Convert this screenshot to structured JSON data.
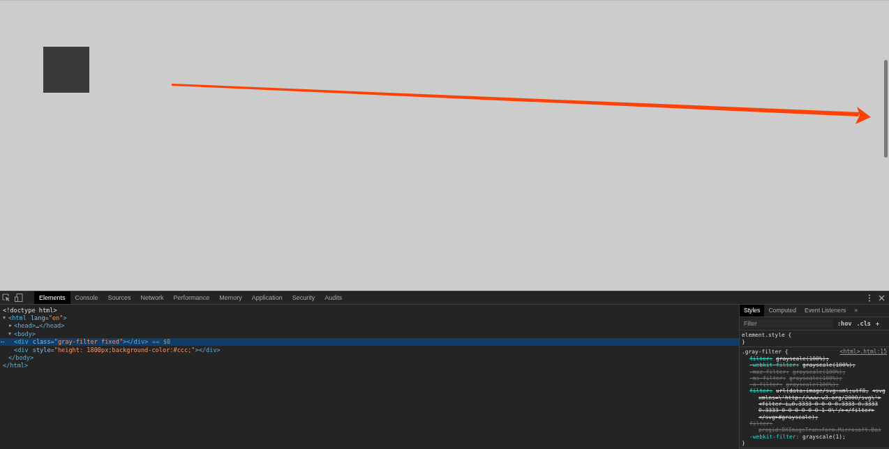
{
  "devtools": {
    "tabs": [
      {
        "label": "Elements",
        "selected": true
      },
      {
        "label": "Console",
        "selected": false
      },
      {
        "label": "Sources",
        "selected": false
      },
      {
        "label": "Network",
        "selected": false
      },
      {
        "label": "Performance",
        "selected": false
      },
      {
        "label": "Memory",
        "selected": false
      },
      {
        "label": "Application",
        "selected": false
      },
      {
        "label": "Security",
        "selected": false
      },
      {
        "label": "Audits",
        "selected": false
      }
    ],
    "dom_tree": [
      {
        "parts": [
          {
            "kind": "plain",
            "text": "<!doctype html>"
          }
        ],
        "selected": false
      },
      {
        "parts": [
          {
            "kind": "tag",
            "text": "<html"
          },
          {
            "kind": "attr",
            "text": "lang="
          },
          {
            "kind": "value",
            "text": "\"en\""
          },
          {
            "kind": "tagend",
            "text": ">"
          }
        ],
        "selected": false,
        "expanded": true,
        "closing": "</html>",
        "children": [
          {
            "parts": [
              {
                "kind": "tag",
                "text": "<head>"
              },
              {
                "kind": "plain",
                "text": "…"
              },
              {
                "kind": "tagend",
                "text": "</head>"
              }
            ],
            "selected": false,
            "expanded": false
          },
          {
            "parts": [
              {
                "kind": "tag",
                "text": "<body>"
              }
            ],
            "selected": false,
            "expanded": true,
            "closing": "</body>",
            "children": [
              {
                "parts": [
                  {
                    "kind": "tag",
                    "text": "<div"
                  },
                  {
                    "kind": "attr",
                    "text": "class="
                  },
                  {
                    "kind": "value",
                    "text": "\"gray-filter fixed\""
                  },
                  {
                    "kind": "tagend",
                    "text": "></div>"
                  },
                  {
                    "kind": "marker",
                    "text": "== $0"
                  }
                ],
                "selected": true
              },
              {
                "parts": [
                  {
                    "kind": "tag",
                    "text": "<div"
                  },
                  {
                    "kind": "attr",
                    "text": "style="
                  },
                  {
                    "kind": "value",
                    "text": "\"height: 1800px;background-color:#ccc;\""
                  },
                  {
                    "kind": "tagend",
                    "text": "></div>"
                  }
                ],
                "selected": false
              }
            ]
          }
        ]
      }
    ],
    "sidebar": {
      "tabs": [
        {
          "label": "Styles",
          "selected": true
        },
        {
          "label": "Computed",
          "selected": false
        },
        {
          "label": "Event Listeners",
          "selected": false
        },
        {
          "label": "»",
          "selected": false
        }
      ],
      "filter": {
        "placeholder": "Filter"
      },
      "buttons": [
        ":hov",
        ".cls",
        "+"
      ],
      "rules": [
        {
          "selector": "element.style {",
          "close": "}"
        },
        {
          "selector": ".gray-filter {",
          "source": "<html>.html:15",
          "close": "}",
          "declarations": [
            {
              "property": "filter:",
              "value": [
                "grayscale(100%);"
              ],
              "overridden": true,
              "invalid": false
            },
            {
              "property": "-webkit-filter:",
              "value": [
                "grayscale(100%);"
              ],
              "overridden": true,
              "invalid": false
            },
            {
              "property": "-moz-filter:",
              "value": [
                "grayscale(100%);"
              ],
              "overridden": true,
              "invalid": true
            },
            {
              "property": "-ms-filter:",
              "value": [
                "grayscale(100%);"
              ],
              "overridden": true,
              "invalid": true
            },
            {
              "property": "-o-filter:",
              "value": [
                "grayscale(100%);"
              ],
              "overridden": true,
              "invalid": true
            },
            {
              "property": "filter:",
              "value": [
                "url(data:image/svg+xml;utf8,",
                "<svg",
                "xmlns=\\'http://www.w3.org/2000/svg\\'>",
                "<filter i…0.3333 0 0 0 0.3333 0.3333",
                "0.3333 0 0 0 0 0 0 1 0\\'/></filter>",
                "</svg>#grayscale);"
              ],
              "overridden": true,
              "invalid": false
            },
            {
              "property": "filter:",
              "value": [
                "progid:DXImageTransform.Microsoft.Bas"
              ],
              "overridden": true,
              "invalid": true
            },
            {
              "property": "-webkit-filter:",
              "value": [
                "grayscale(1);"
              ],
              "overridden": false,
              "invalid": false
            }
          ]
        }
      ]
    }
  }
}
